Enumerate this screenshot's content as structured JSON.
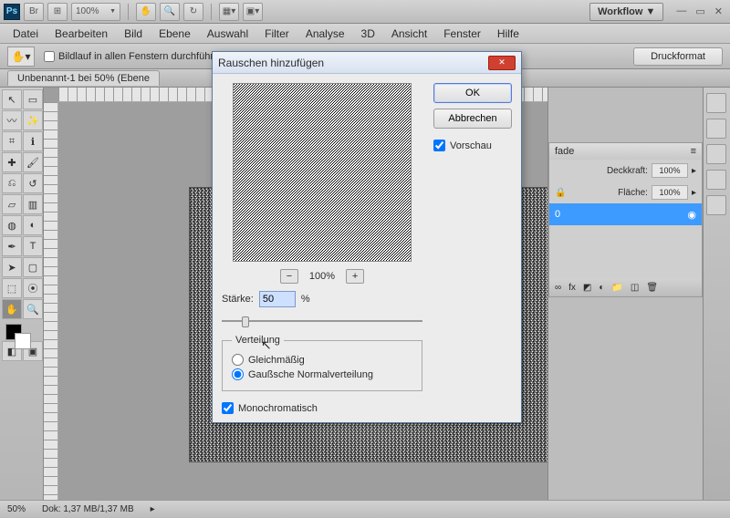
{
  "top": {
    "zoom": "100%",
    "workflow": "Workflow ▼"
  },
  "menu": [
    "Datei",
    "Bearbeiten",
    "Bild",
    "Ebene",
    "Auswahl",
    "Filter",
    "Analyse",
    "3D",
    "Ansicht",
    "Fenster",
    "Hilfe"
  ],
  "options": {
    "scroll_all": "Bildlauf in allen Fenstern durchführen",
    "print_format": "Druckformat"
  },
  "doc_tab": "Unbenannt-1 bei 50% (Ebene",
  "layers": {
    "tab": "fade",
    "opacity_label": "Deckkraft:",
    "opacity_val": "100%",
    "fill_label": "Fläche:",
    "fill_val": "100%",
    "row": "0",
    "foot_fx": "fx"
  },
  "status": {
    "zoom": "50%",
    "docsize": "Dok: 1,37 MB/1,37 MB"
  },
  "dialog": {
    "title": "Rauschen hinzufügen",
    "ok": "OK",
    "cancel": "Abbrechen",
    "preview_chk": "Vorschau",
    "preview_zoom": "100%",
    "strength_label": "Stärke:",
    "strength_val": "50",
    "strength_unit": "%",
    "dist_legend": "Verteilung",
    "dist_uniform": "Gleichmäßig",
    "dist_gaussian": "Gaußsche Normalverteilung",
    "mono": "Monochromatisch"
  }
}
